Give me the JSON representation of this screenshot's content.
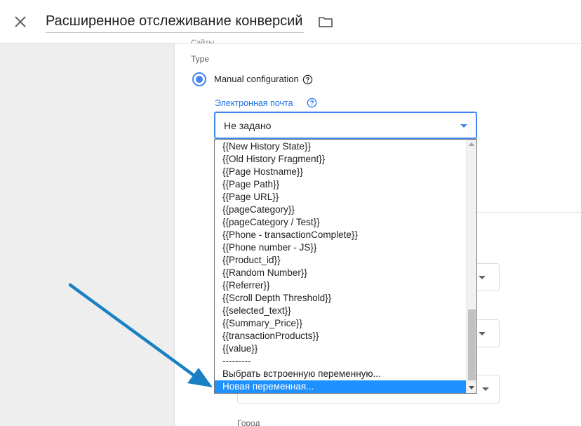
{
  "header": {
    "title": "Расширенное отслеживание конверсий",
    "close_icon": "close-icon",
    "folder_icon": "folder-icon"
  },
  "form": {
    "clipped_label": "Сайты",
    "type_label": "Type",
    "radio_label": "Manual configuration",
    "email_label": "Электронная почта",
    "select_value": "Не задано",
    "city_label": "Город"
  },
  "dropdown": {
    "options": [
      "{{New History State}}",
      "{{Old History Fragment}}",
      "{{Page Hostname}}",
      "{{Page Path}}",
      "{{Page URL}}",
      "{{pageCategory}}",
      "{{pageCategory / Test}}",
      "{{Phone - transactionComplete}}",
      "{{Phone number - JS}}",
      "{{Product_id}}",
      "{{Random Number}}",
      "{{Referrer}}",
      "{{Scroll Depth Threshold}}",
      "{{selected_text}}",
      "{{Summary_Price}}",
      "{{transactionProducts}}",
      "{{value}}",
      "---------",
      "Выбрать встроенную переменную...",
      "Новая переменная..."
    ],
    "selected": "Новая переменная..."
  },
  "colors": {
    "accent": "#4285f4",
    "selected_bg": "#1e90ff",
    "arrow": "#1a80c4"
  }
}
